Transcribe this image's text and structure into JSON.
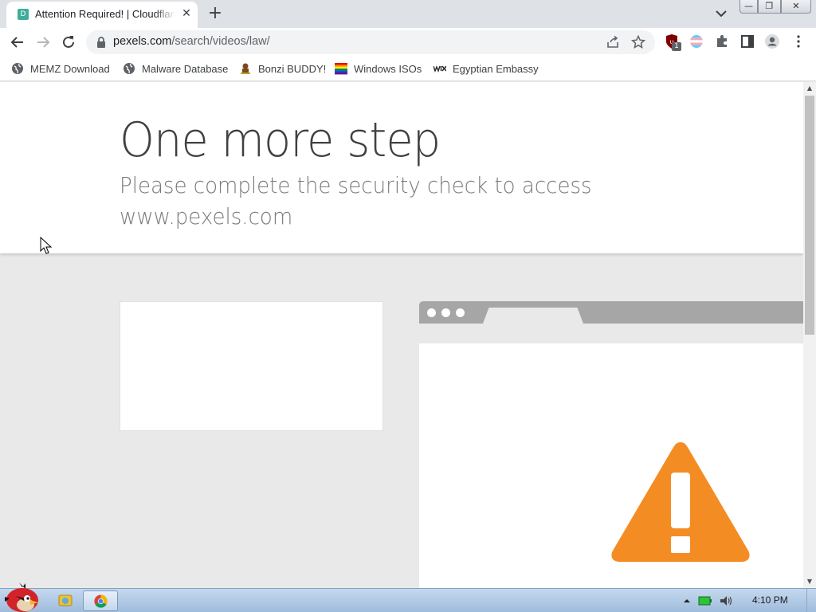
{
  "browser": {
    "tab": {
      "title": "Attention Required! | Cloudflare",
      "favicon_letter": "D"
    },
    "window_controls": {
      "minimize": "—",
      "restore": "❐",
      "close": "✕"
    },
    "url": {
      "domain": "pexels.com",
      "path": "/search/videos/law/"
    },
    "bookmarks": [
      {
        "label": "MEMZ Download",
        "icon": "globe-icon"
      },
      {
        "label": "Malware Database",
        "icon": "globe-icon"
      },
      {
        "label": "Bonzi BUDDY!",
        "icon": "bonzi-icon"
      },
      {
        "label": "Windows ISOs",
        "icon": "rainbow-flag-icon"
      },
      {
        "label": "Egyptian Embassy",
        "icon": "wix-icon"
      }
    ],
    "extension_badge": "1"
  },
  "page": {
    "heading": "One more step",
    "subtitle_line1": "Please complete the security check to access",
    "subtitle_line2": "www.pexels.com"
  },
  "taskbar": {
    "clock": "4:10 PM"
  },
  "colors": {
    "warning": "#f48c24",
    "page_bg": "#e9e9e9",
    "header_bg": "#ffffff"
  }
}
